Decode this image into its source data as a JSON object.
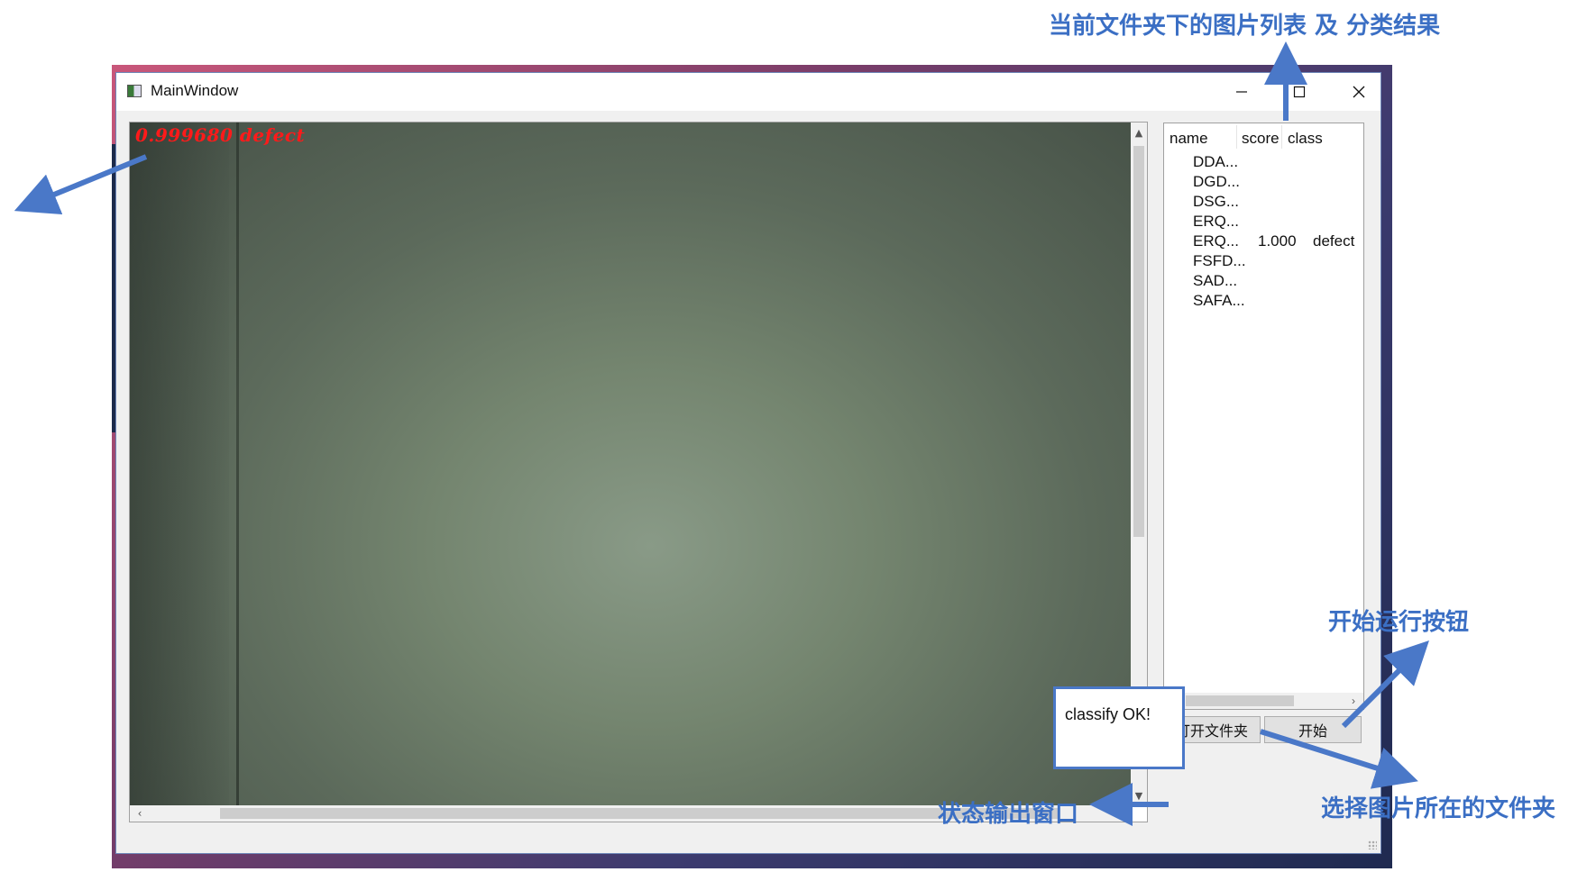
{
  "window": {
    "title": "MainWindow",
    "controls": {
      "minimize": "—",
      "maximize": "☐",
      "close": "✕"
    }
  },
  "viewer": {
    "overlay_label": "0.999680  defect"
  },
  "file_list": {
    "columns": [
      "name",
      "score",
      "class"
    ],
    "rows": [
      {
        "name": "DDA...",
        "score": "",
        "class": ""
      },
      {
        "name": "DGD...",
        "score": "",
        "class": ""
      },
      {
        "name": "DSG...",
        "score": "",
        "class": ""
      },
      {
        "name": "ERQ...",
        "score": "",
        "class": ""
      },
      {
        "name": "ERQ...",
        "score": "1.000",
        "class": "defect"
      },
      {
        "name": "FSFD...",
        "score": "",
        "class": ""
      },
      {
        "name": "SAD...",
        "score": "",
        "class": ""
      },
      {
        "name": "SAFA...",
        "score": "",
        "class": ""
      }
    ]
  },
  "buttons": {
    "open_folder": "打开文件夹",
    "start": "开始"
  },
  "status": {
    "text": "classify OK!"
  },
  "annotations": {
    "list_label": "当前文件夹下的图片列表 及 分类结果",
    "start_label": "开始运行按钮",
    "status_label": "状态输出窗口",
    "folder_label": "选择图片所在的文件夹"
  },
  "colors": {
    "annotation": "#3b6fc4",
    "overlay_text": "#ff1a1a"
  }
}
